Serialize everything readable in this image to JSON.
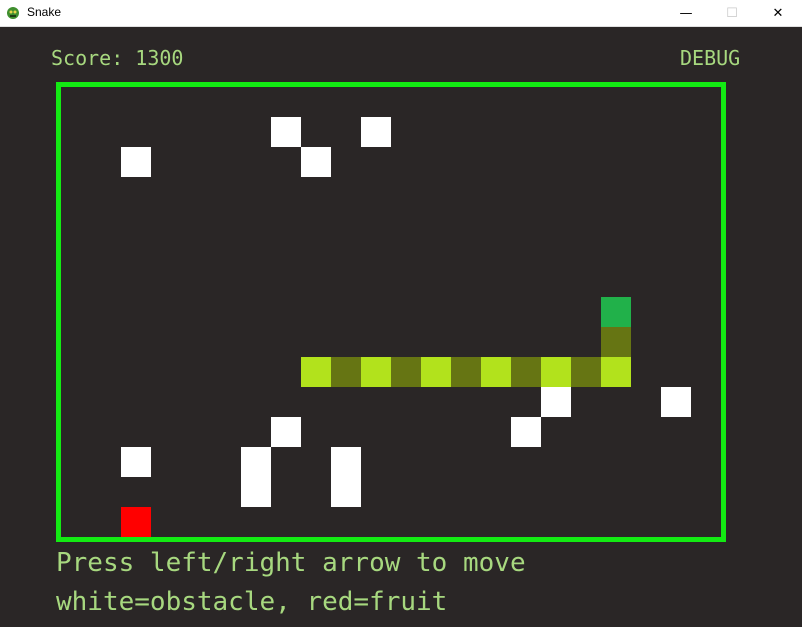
{
  "window": {
    "title": "Snake",
    "minimize_glyph": "—",
    "maximize_glyph": "☐",
    "close_glyph": "✕"
  },
  "hud": {
    "score_text": "Score: 1300",
    "mode_text": "DEBUG"
  },
  "help": {
    "line1": "Press left/right arrow to move",
    "line2": "white=obstacle, red=fruit"
  },
  "colors": {
    "background": "#2a2626",
    "border": "#13ea13",
    "hud_text": "#a7d87f",
    "obstacle": "#ffffff",
    "fruit": "#ff0000",
    "snake_head": "#21b14a",
    "snake_dark": "#667513",
    "snake_light": "#b2e21c"
  },
  "board": {
    "obstacles": [
      {
        "col": 7,
        "row": 1
      },
      {
        "col": 10,
        "row": 1
      },
      {
        "col": 2,
        "row": 2
      },
      {
        "col": 8,
        "row": 2
      },
      {
        "col": 16,
        "row": 10
      },
      {
        "col": 20,
        "row": 10
      },
      {
        "col": 7,
        "row": 11
      },
      {
        "col": 15,
        "row": 11
      },
      {
        "col": 2,
        "row": 12
      },
      {
        "col": 6,
        "row": 12
      },
      {
        "col": 9,
        "row": 12
      },
      {
        "col": 6,
        "row": 13
      },
      {
        "col": 9,
        "row": 13
      }
    ],
    "fruit": {
      "col": 2,
      "row": 14
    },
    "snake": [
      {
        "col": 18,
        "row": 7,
        "part": "head"
      },
      {
        "col": 18,
        "row": 8,
        "part": "dark"
      },
      {
        "col": 18,
        "row": 9,
        "part": "light"
      },
      {
        "col": 17,
        "row": 9,
        "part": "dark"
      },
      {
        "col": 16,
        "row": 9,
        "part": "light"
      },
      {
        "col": 15,
        "row": 9,
        "part": "dark"
      },
      {
        "col": 14,
        "row": 9,
        "part": "light"
      },
      {
        "col": 13,
        "row": 9,
        "part": "dark"
      },
      {
        "col": 12,
        "row": 9,
        "part": "light"
      },
      {
        "col": 11,
        "row": 9,
        "part": "dark"
      },
      {
        "col": 10,
        "row": 9,
        "part": "light"
      },
      {
        "col": 9,
        "row": 9,
        "part": "dark"
      },
      {
        "col": 8,
        "row": 9,
        "part": "light"
      }
    ]
  }
}
